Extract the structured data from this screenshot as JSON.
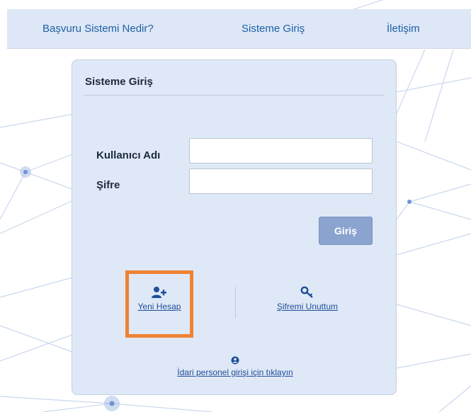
{
  "nav": {
    "items": [
      {
        "label": "Başvuru Sistemi Nedir?"
      },
      {
        "label": "Sisteme Giriş"
      },
      {
        "label": "İletişim"
      }
    ]
  },
  "login_panel": {
    "title": "Sisteme Giriş",
    "username_label": "Kullanıcı Adı",
    "username_value": "",
    "password_label": "Şifre",
    "password_value": "",
    "submit_label": "Giriş"
  },
  "actions": {
    "new_account": {
      "label": "Yeni Hesap",
      "icon": "user-plus-icon"
    },
    "forgot_password": {
      "label": "Şifremi Unuttum",
      "icon": "key-icon"
    },
    "admin_login": {
      "label": "İdari personel girişi için tıklayın",
      "icon": "user-circle-icon"
    }
  },
  "colors": {
    "nav_bg": "#dde7f5",
    "panel_bg": "#dfe8f6",
    "link": "#1f5fa8",
    "button": "#8ba3cf",
    "highlight": "#f08233"
  }
}
